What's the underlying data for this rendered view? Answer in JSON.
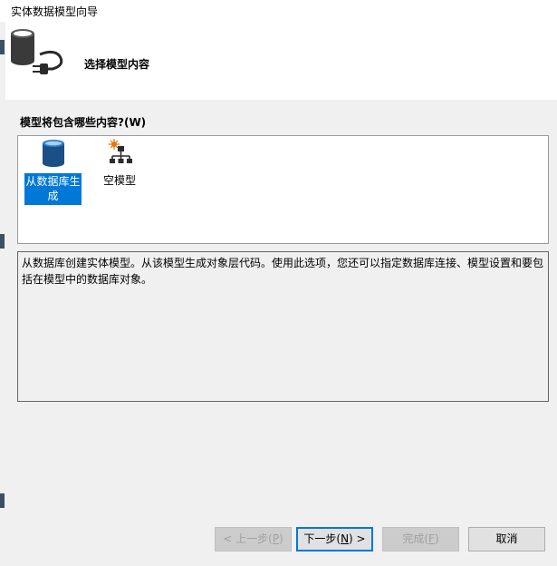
{
  "window": {
    "title": "实体数据模型向导"
  },
  "header": {
    "heading": "选择模型内容",
    "icon": "database-connect-icon"
  },
  "content": {
    "prompt": "模型将包含哪些内容?(W)",
    "options": [
      {
        "label": "从数据库生成",
        "icon": "database-icon",
        "selected": true
      },
      {
        "label": "空模型",
        "icon": "empty-model-icon",
        "selected": false
      }
    ],
    "description": "从数据库创建实体模型。从该模型生成对象层代码。使用此选项，您还可以指定数据库连接、模型设置和要包括在模型中的数据库对象。"
  },
  "buttons": {
    "back": {
      "label": "< 上一步(",
      "key": "P",
      "suffix": ")",
      "enabled": false
    },
    "next": {
      "label": "下一步(",
      "key": "N",
      "suffix": ") >",
      "enabled": true
    },
    "finish": {
      "label": "完成(",
      "key": "F",
      "suffix": ")",
      "enabled": false
    },
    "cancel": {
      "label": "取消",
      "enabled": true
    }
  },
  "colors": {
    "selection": "#0078d7",
    "background": "#f0f0f0",
    "panel": "#ffffff"
  }
}
